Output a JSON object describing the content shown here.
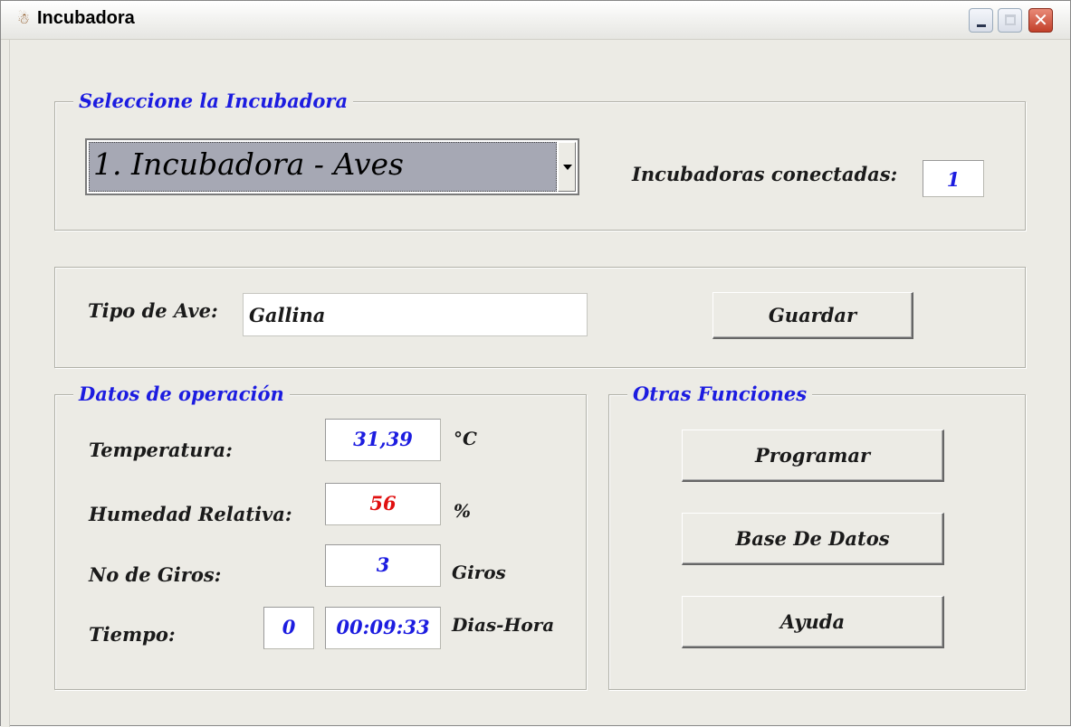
{
  "window": {
    "title": "Incubadora",
    "app_icon": "incubator-icon",
    "controls": [
      "minimize-icon",
      "maximize-icon",
      "close-icon"
    ],
    "close_glyph": "✕"
  },
  "selector": {
    "legend": "Seleccione la Incubadora",
    "selected": "1. Incubadora - Aves",
    "connected_label": "Incubadoras conectadas:",
    "connected_count": "1"
  },
  "bird": {
    "label": "Tipo de Ave:",
    "value": "Gallina",
    "save_button": "Guardar"
  },
  "operation": {
    "legend": "Datos de operación",
    "temperature": {
      "label": "Temperatura:",
      "value": "31,39",
      "unit": "°C"
    },
    "humidity": {
      "label": "Humedad Relativa:",
      "value": "56",
      "unit": "%"
    },
    "turns": {
      "label": "No de Giros:",
      "value": "3",
      "unit": "Giros"
    },
    "time": {
      "label": "Tiempo:",
      "days": "0",
      "hours": "00:09:33",
      "unit": "Dias-Hora"
    }
  },
  "functions": {
    "legend": "Otras Funciones",
    "program_button": "Programar",
    "database_button": "Base De Datos",
    "help_button": "Ayuda"
  },
  "colors": {
    "accent_blue": "#1c1ce0",
    "humidity_red": "#e01010",
    "window_bg": "#ecebe5"
  }
}
